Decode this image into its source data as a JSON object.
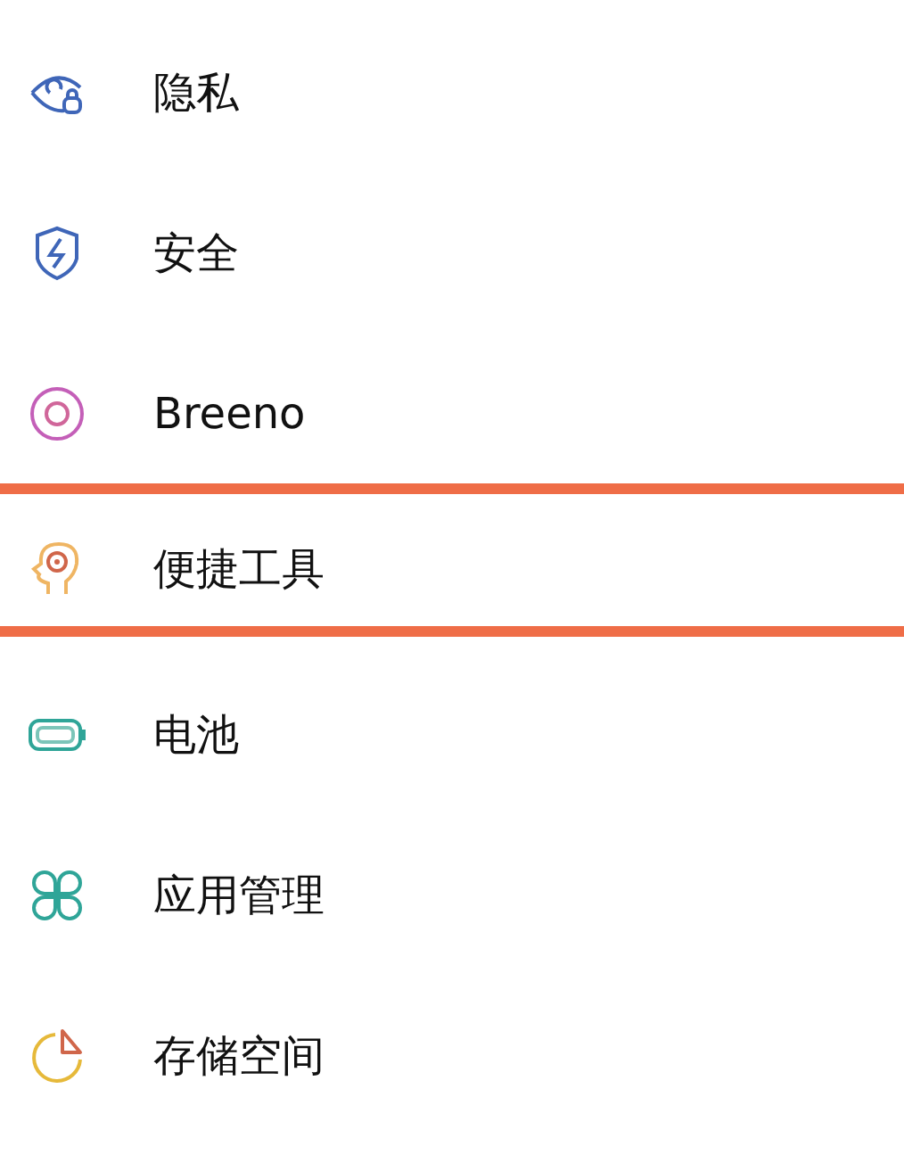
{
  "items": [
    {
      "label": "隐私",
      "selected": false
    },
    {
      "label": "安全",
      "selected": false
    },
    {
      "label": "Breeno",
      "selected": false
    },
    {
      "label": "便捷工具",
      "selected": true
    },
    {
      "label": "电池",
      "selected": false
    },
    {
      "label": "应用管理",
      "selected": false
    },
    {
      "label": "存储空间",
      "selected": false
    }
  ]
}
